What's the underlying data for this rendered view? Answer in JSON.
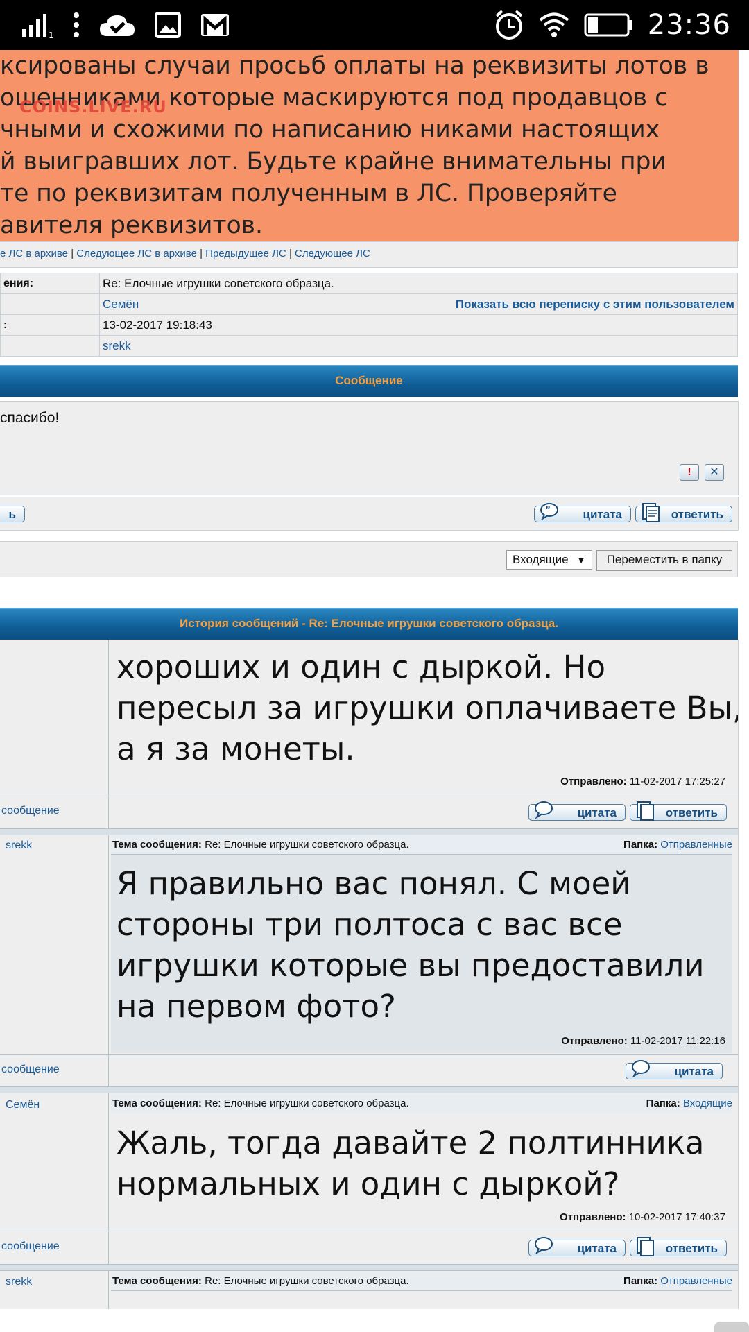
{
  "status_bar": {
    "time": "23:36",
    "signal_sub": "1",
    "icons": [
      "signal-icon",
      "more-icon",
      "cloud-check-icon",
      "gallery-icon",
      "gmail-icon",
      "alarm-icon",
      "wifi-icon",
      "battery-icon"
    ]
  },
  "warning": {
    "lines": [
      "ксированы случаи просьб оплаты на реквизиты лотов в",
      "ошенниками которые маскируются под продавцов с",
      "чными и схожими по написанию никами настоящих",
      "й выигравших лот. Будьте крайне внимательны при",
      "те по реквизитам полученным в ЛС. Проверяйте",
      "авителя реквизитов."
    ],
    "watermark": "COINS.LIVE.RU",
    "color": "#f79368"
  },
  "nav": {
    "prev_archive": "е ЛС в архиве",
    "next_archive": "Следующее ЛС в архиве",
    "prev": "Предыдущее ЛС",
    "next": "Следующее ЛС"
  },
  "info": {
    "subject_label": "ения:",
    "subject_value": "Re: Елочные игрушки советского образца.",
    "from_value": "Семён",
    "show_all_link": "Показать всю переписку с этим пользователем",
    "date_label": ":",
    "date_value": "13-02-2017 19:18:43",
    "to_value": "srekk"
  },
  "message": {
    "header": "Сообщение",
    "text": "спасибо!",
    "report_symbol": "!",
    "delete_symbol": "✕",
    "left_button": "ь",
    "quote_button": "цитата",
    "reply_button": "ответить"
  },
  "folder_controls": {
    "selected_folder": "Входящие",
    "move_button": "Переместить в папку"
  },
  "history": {
    "header": "История сообщений - Re: Елочные игрушки советского образца.",
    "subject_label": "Тема сообщения:",
    "folder_label": "Папка:",
    "sent_label": "Отправлено:",
    "quote_button": "цитата",
    "reply_button": "ответить",
    "message_link": "сообщение",
    "items": [
      {
        "text": "хороших и один с дыркой. Но\nпересыл за игрушки оплачиваете Вы,\nа я за монеты.",
        "sent": "11-02-2017 17:25:27"
      },
      {
        "user": "srekk",
        "subject": "Re: Елочные игрушки советского образца.",
        "folder": "Отправленные",
        "text": "Я правильно вас понял. С моей\nстороны три полтоса с вас все\nигрушки которые вы предоставили\nна первом фото?",
        "sent": "11-02-2017 11:22:16"
      },
      {
        "user": "Семён",
        "subject": "Re: Елочные игрушки советского образца.",
        "folder": "Входящие",
        "text": "Жаль, тогда давайте 2 полтинника\nнормальных и один с дыркой?",
        "sent": "10-02-2017 17:40:37"
      },
      {
        "user": "srekk",
        "subject": "Re: Елочные игрушки советского образца.",
        "folder": "Отправленные"
      }
    ]
  }
}
